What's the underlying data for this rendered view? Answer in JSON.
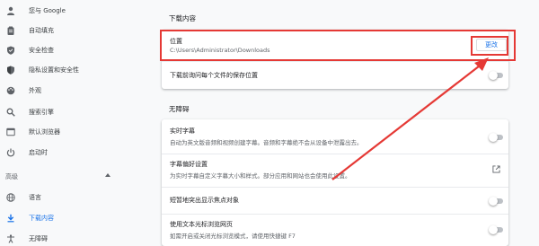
{
  "sidebar": {
    "items": [
      {
        "label": "您与 Google",
        "icon": "person-icon"
      },
      {
        "label": "自动填充",
        "icon": "clipboard-icon"
      },
      {
        "label": "安全检查",
        "icon": "shield-check-icon"
      },
      {
        "label": "隐私设置和安全性",
        "icon": "shield-icon"
      },
      {
        "label": "外观",
        "icon": "palette-icon"
      },
      {
        "label": "搜索引擎",
        "icon": "search-icon"
      },
      {
        "label": "默认浏览器",
        "icon": "browser-icon"
      },
      {
        "label": "启动时",
        "icon": "power-icon"
      }
    ],
    "advanced_label": "高级",
    "advanced_items": [
      {
        "label": "语言",
        "icon": "globe-icon"
      },
      {
        "label": "下载内容",
        "icon": "download-icon",
        "active": true
      },
      {
        "label": "无障碍",
        "icon": "accessibility-icon"
      }
    ]
  },
  "downloads": {
    "section_title": "下载内容",
    "location_label": "位置",
    "location_path": "C:\\Users\\Administrator\\Downloads",
    "change_button": "更改",
    "ask_label": "下载前询问每个文件的保存位置"
  },
  "accessibility": {
    "section_title": "无障碍",
    "live_caption_title": "实时字幕",
    "live_caption_desc": "自动为英文版音频和视频创建字幕。音频和字幕绝不会从设备中泄露出去。",
    "caption_prefs_title": "字幕偏好设置",
    "caption_prefs_desc": "为实时字幕自定义字幕大小和样式。部分应用和网站也会使用此设置。",
    "focus_highlight_title": "短暂地突出显示焦点对象",
    "caret_title": "使用文本光标浏览网页",
    "caret_desc": "如需开启或关闭光标浏览模式，请使用快捷键 F7"
  },
  "colors": {
    "accent": "#1a73e8",
    "highlight": "#e53935"
  }
}
